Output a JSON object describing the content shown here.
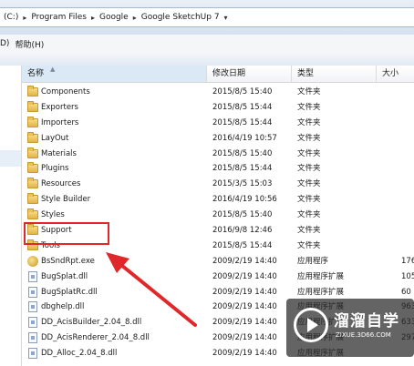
{
  "address": {
    "crumbs": [
      "(C:)",
      "Program Files",
      "Google",
      "Google SketchUp 7"
    ]
  },
  "menu": {
    "items": [
      "D)",
      "帮助(H)"
    ]
  },
  "columns": {
    "name": "名称",
    "date": "修改日期",
    "type": "类型",
    "size": "大小"
  },
  "files": [
    {
      "name": "Components",
      "date": "2015/8/5 15:40",
      "type": "文件夹",
      "size": "",
      "kind": "folder"
    },
    {
      "name": "Exporters",
      "date": "2015/8/5 15:44",
      "type": "文件夹",
      "size": "",
      "kind": "folder"
    },
    {
      "name": "Importers",
      "date": "2015/8/5 15:44",
      "type": "文件夹",
      "size": "",
      "kind": "folder"
    },
    {
      "name": "LayOut",
      "date": "2016/4/19 10:57",
      "type": "文件夹",
      "size": "",
      "kind": "folder"
    },
    {
      "name": "Materials",
      "date": "2015/8/5 15:40",
      "type": "文件夹",
      "size": "",
      "kind": "folder"
    },
    {
      "name": "Plugins",
      "date": "2015/8/5 15:44",
      "type": "文件夹",
      "size": "",
      "kind": "folder"
    },
    {
      "name": "Resources",
      "date": "2015/3/5 15:03",
      "type": "文件夹",
      "size": "",
      "kind": "folder"
    },
    {
      "name": "Style Builder",
      "date": "2016/4/19 10:56",
      "type": "文件夹",
      "size": "",
      "kind": "folder"
    },
    {
      "name": "Styles",
      "date": "2015/8/5 15:40",
      "type": "文件夹",
      "size": "",
      "kind": "folder"
    },
    {
      "name": "Support",
      "date": "2016/9/8 12:46",
      "type": "文件夹",
      "size": "",
      "kind": "folder"
    },
    {
      "name": "Tools",
      "date": "2015/8/5 15:44",
      "type": "文件夹",
      "size": "",
      "kind": "folder"
    },
    {
      "name": "BsSndRpt.exe",
      "date": "2009/2/19 14:40",
      "type": "应用程序",
      "size": "176",
      "kind": "exe"
    },
    {
      "name": "BugSplat.dll",
      "date": "2009/2/19 14:40",
      "type": "应用程序扩展",
      "size": "105",
      "kind": "dll"
    },
    {
      "name": "BugSplatRc.dll",
      "date": "2009/2/19 14:40",
      "type": "应用程序扩展",
      "size": "60",
      "kind": "dll"
    },
    {
      "name": "dbghelp.dll",
      "date": "2009/2/19 14:40",
      "type": "应用程序扩展",
      "size": "963",
      "kind": "dll"
    },
    {
      "name": "DD_AcisBuilder_2.04_8.dll",
      "date": "2009/2/19 14:40",
      "type": "应用程序扩展",
      "size": "633",
      "kind": "dll"
    },
    {
      "name": "DD_AcisRenderer_2.04_8.dll",
      "date": "2009/2/19 14:40",
      "type": "应用程序扩展",
      "size": "297",
      "kind": "dll"
    },
    {
      "name": "DD_Alloc_2.04_8.dll",
      "date": "2009/2/19 14:40",
      "type": "应用程序扩展",
      "size": "",
      "kind": "dll"
    }
  ],
  "watermark": {
    "title": "溜溜自学",
    "subtitle": "ZIXUE.3D66.COM"
  },
  "colors": {
    "highlight": "#e0282a",
    "header_sorted": "#dbe9f6"
  }
}
